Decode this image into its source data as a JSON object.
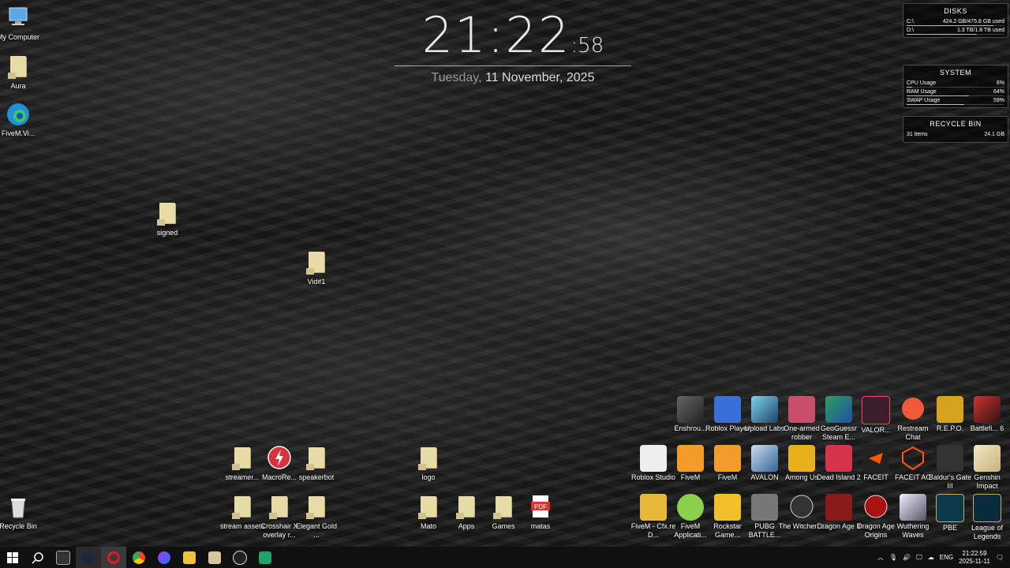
{
  "clock": {
    "time": "21:22",
    "seconds": ":58",
    "weekday": "Tuesday,",
    "date": "11 November, 2025"
  },
  "widgets": {
    "disks": {
      "title": "DISKS",
      "rows": [
        {
          "label": "C:\\",
          "value": "424.2 GB/475.8 GB used",
          "fill": 0.89
        },
        {
          "label": "D:\\",
          "value": "1.3 TB/1.8 TB used",
          "fill": 0.72
        }
      ]
    },
    "system": {
      "title": "SYSTEM",
      "rows": [
        {
          "label": "CPU Usage",
          "value": "6%",
          "fill": 0.06
        },
        {
          "label": "RAM Usage",
          "value": "64%",
          "fill": 0.64
        },
        {
          "label": "SWAP Usage",
          "value": "59%",
          "fill": 0.59
        }
      ]
    },
    "recycle": {
      "title": "RECYCLE BIN",
      "items": "31 items",
      "size": "24.1 GB"
    }
  },
  "desktop": {
    "left": [
      "My Computer",
      "Aura",
      "FiveM.Vi..."
    ],
    "scattered": [
      "signed",
      "Vid#1"
    ],
    "recycle_bin": "Recycle Bin",
    "bottom_row1": [
      "streamer...",
      "MacroRe...",
      "speakerbot",
      "logo"
    ],
    "bottom_row2": [
      "stream assets",
      "Crosshair X overlay r...",
      "Elegant Gold ...",
      "Mato",
      "Apps",
      "Games",
      "matas"
    ],
    "grid_row1": [
      "Enshrou...",
      "Roblox Player",
      "Upload Labs",
      "One-armed robber",
      "GeoGuessr Steam E...",
      "VALOR...",
      "Restream Chat",
      "R.E.P.O.",
      "Battlefi... 6"
    ],
    "grid_row2": [
      "Roblox Studio",
      "FiveM",
      "FiveM",
      "AVALON",
      "Among Us",
      "Dead Island 2",
      "FACEIT",
      "FACEIT AC",
      "Baldur's Gate III",
      "Genshin Impact"
    ],
    "grid_row3": [
      "FiveM - Cfx.re D...",
      "FiveM Applicati...",
      "Rockstar Game...",
      "PUBG BATTLE...",
      "The Witcher ...",
      "Dragon Age II",
      "Dragon Age Origins",
      "Wuthering Waves",
      "PBE",
      "League of Legends"
    ]
  },
  "taskbar": {
    "tray": {
      "lang": "ENG",
      "time": "21:22:59",
      "date": "2025-11-11"
    }
  },
  "colors": {
    "folder": "#e8dca6",
    "taskbar": "#101010"
  }
}
